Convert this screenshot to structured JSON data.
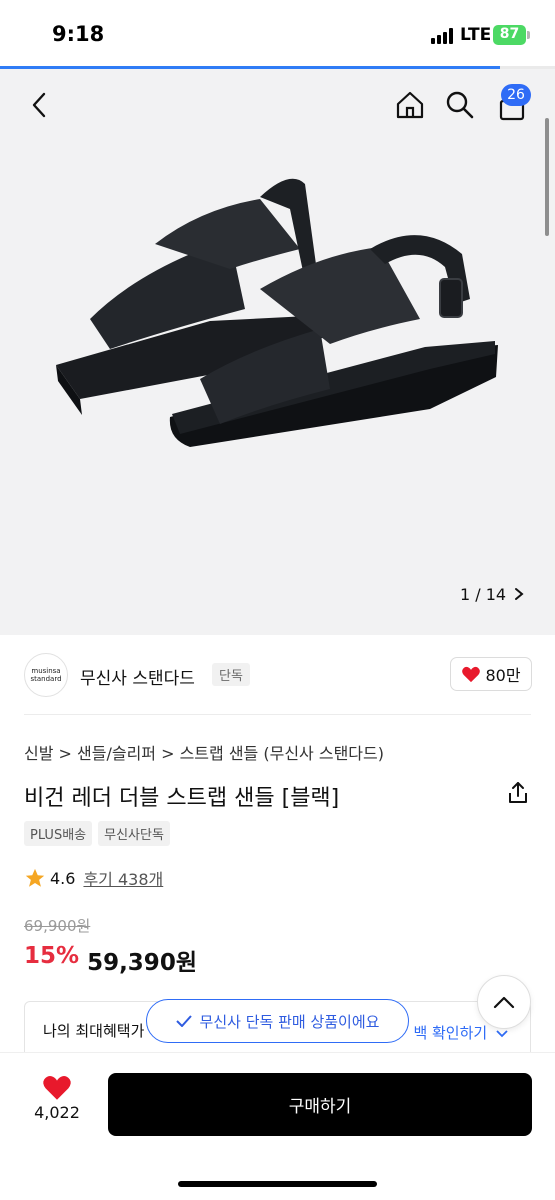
{
  "status_bar": {
    "time": "9:18",
    "network": "LTE",
    "battery": "87"
  },
  "loading": {
    "progress": 0.9
  },
  "colors": {
    "accent_blue": "#2f6cf6",
    "discount_red": "#e62d3f",
    "like_red": "#e8192c",
    "star_orange": "#f5a623"
  },
  "header": {
    "back_icon": "chevron-left-icon",
    "home_icon": "home-icon",
    "search_icon": "search-icon",
    "cart_icon": "bag-icon",
    "cart_count": "26"
  },
  "hero": {
    "image_index": "1 / 14"
  },
  "brand": {
    "logo_line1": "musinsa",
    "logo_line2": "standard",
    "name": "무신사 스탠다드",
    "badge": "단독",
    "likes": "80만"
  },
  "product": {
    "breadcrumb": "신발 > 샌들/슬리퍼 > 스트랩 샌들 (무신사 스탠다드)",
    "title": "비건 레더 더블 스트랩 샌들 [블랙]",
    "tags": [
      "PLUS배송",
      "무신사단독"
    ],
    "rating": "4.6",
    "reviews": "후기 438개",
    "original_price": "69,900원",
    "discount": "15%",
    "price": "59,390원"
  },
  "benefit": {
    "label": "나의 최대혜택가",
    "link": "백 확인하기"
  },
  "toast": {
    "text": "무신사 단독 판매 상품이에요"
  },
  "bottom": {
    "like_count": "4,022",
    "buy_label": "구매하기"
  }
}
